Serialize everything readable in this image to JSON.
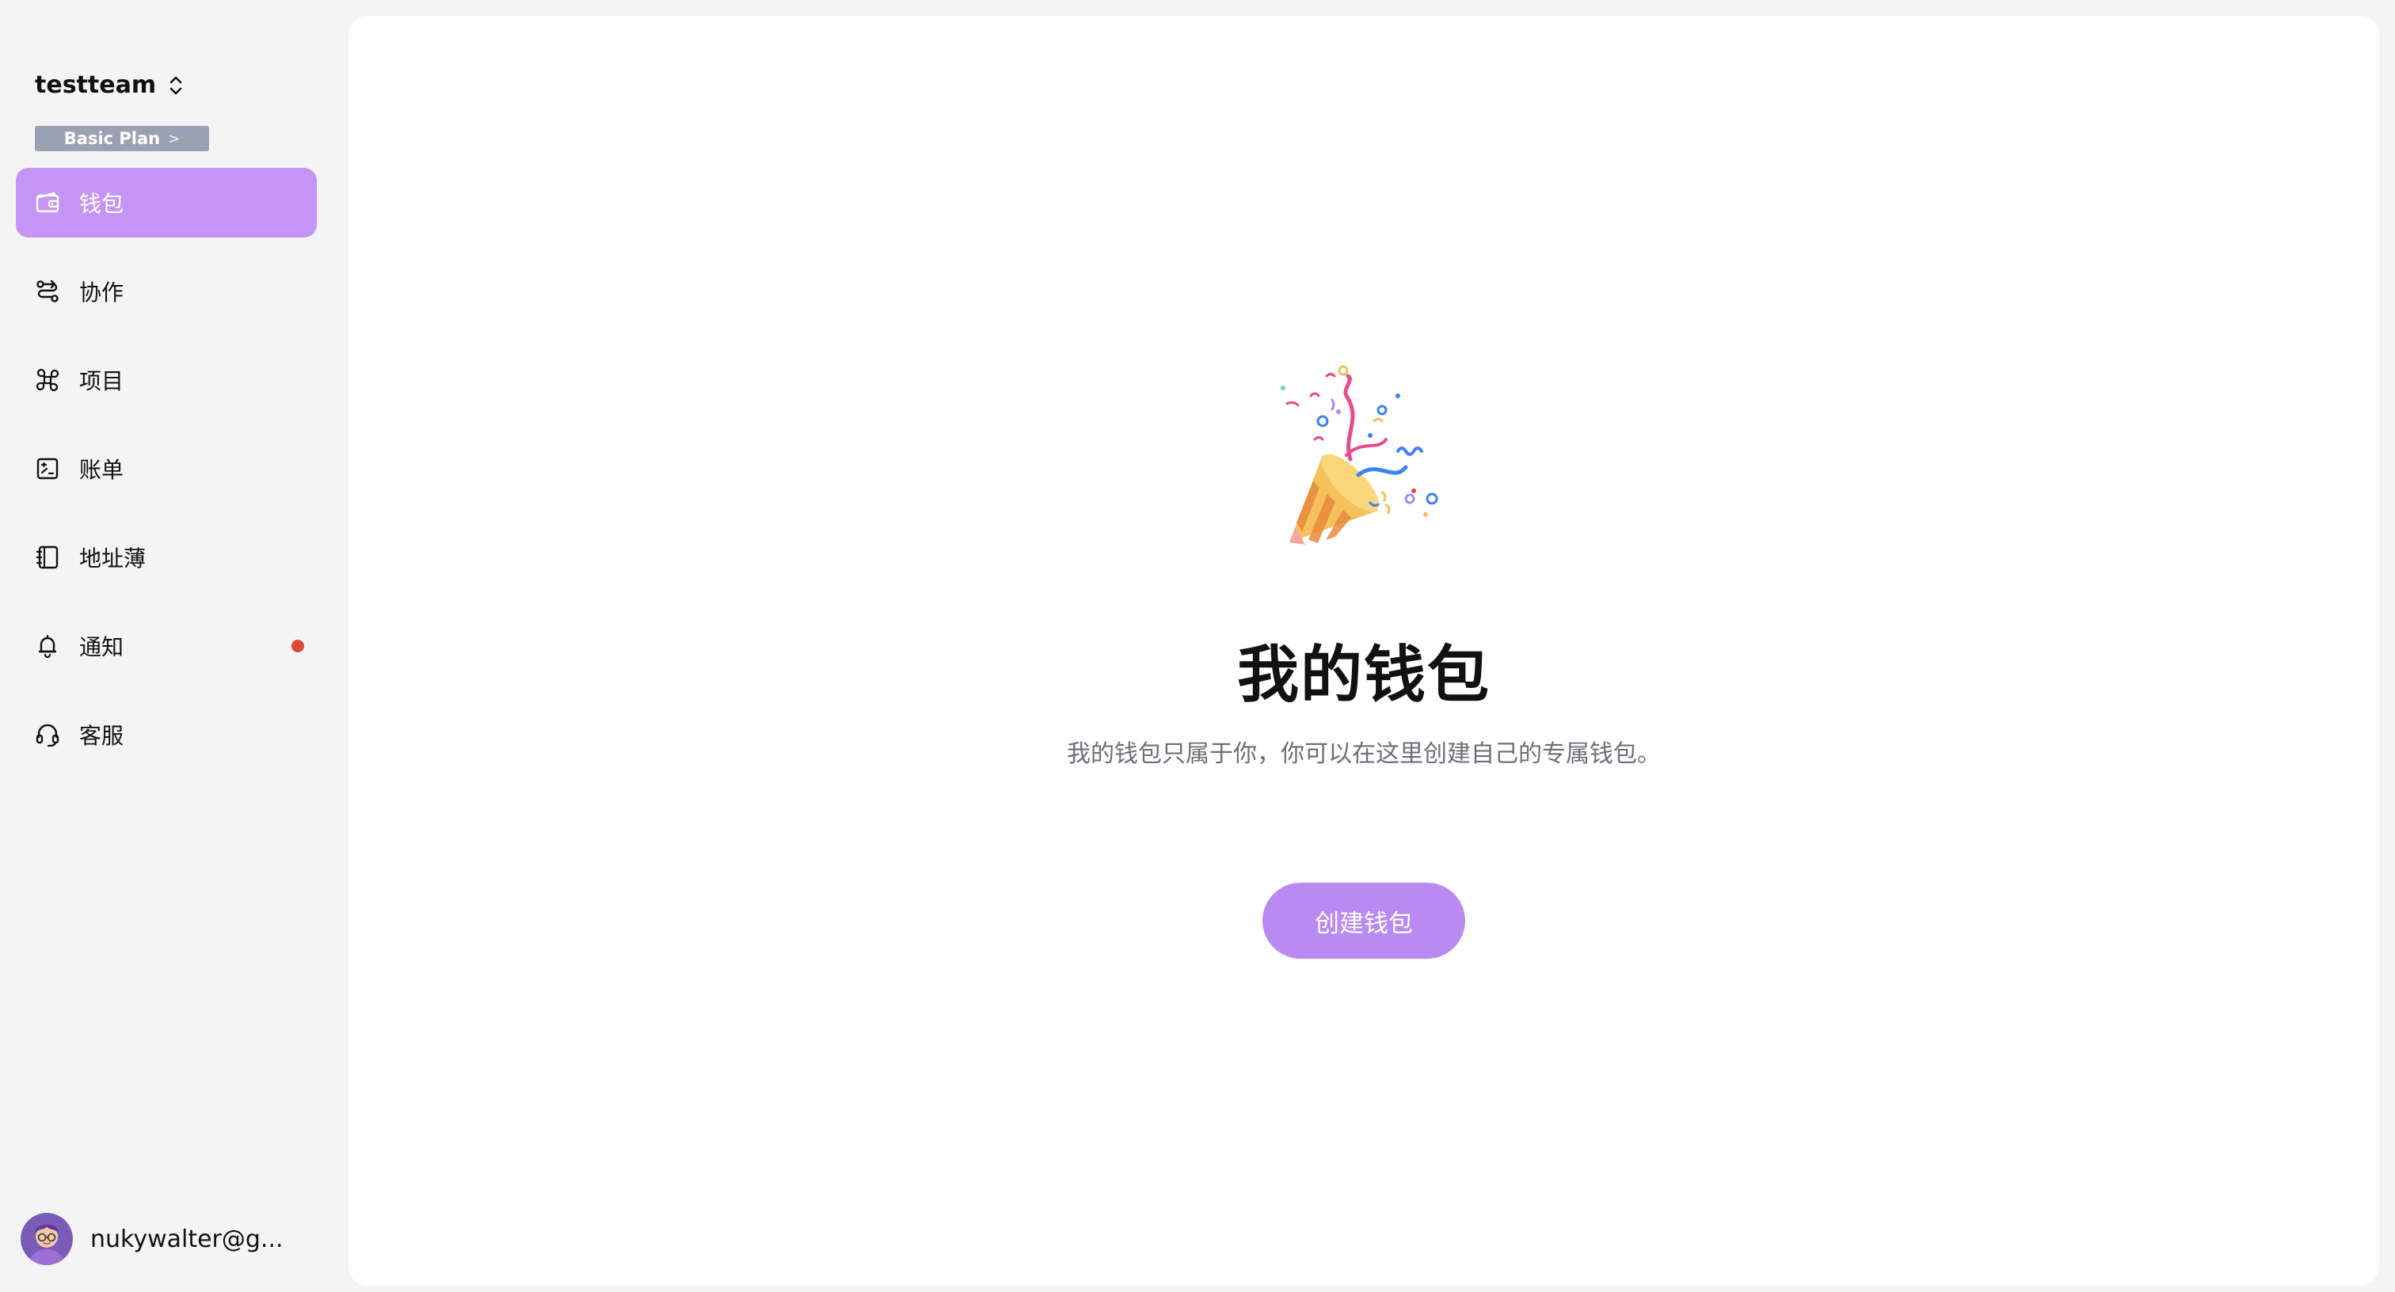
{
  "team": {
    "name": "testteam",
    "plan_label": "Basic Plan",
    "plan_arrow": ">"
  },
  "nav": {
    "items": [
      {
        "label": "钱包",
        "icon": "wallet-icon",
        "active": true
      },
      {
        "label": "协作",
        "icon": "route-icon",
        "active": false
      },
      {
        "label": "项目",
        "icon": "command-icon",
        "active": false
      },
      {
        "label": "账单",
        "icon": "bill-icon",
        "active": false
      },
      {
        "label": "地址薄",
        "icon": "address-book-icon",
        "active": false
      },
      {
        "label": "通知",
        "icon": "bell-icon",
        "active": false,
        "has_unread": true
      },
      {
        "label": "客服",
        "icon": "headset-icon",
        "active": false
      }
    ]
  },
  "user": {
    "email": "nukywalter@g..."
  },
  "empty_state": {
    "icon": "party-popper-icon",
    "title": "我的钱包",
    "description": "我的钱包只属于你，你可以在这里创建自己的专属钱包。",
    "button_label": "创建钱包"
  },
  "colors": {
    "accent": "#c595f5",
    "button": "#b98af2",
    "badge": "#9aa2b1",
    "notification_dot": "#e0463a",
    "background": "#f4f4f5",
    "panel": "#ffffff"
  }
}
